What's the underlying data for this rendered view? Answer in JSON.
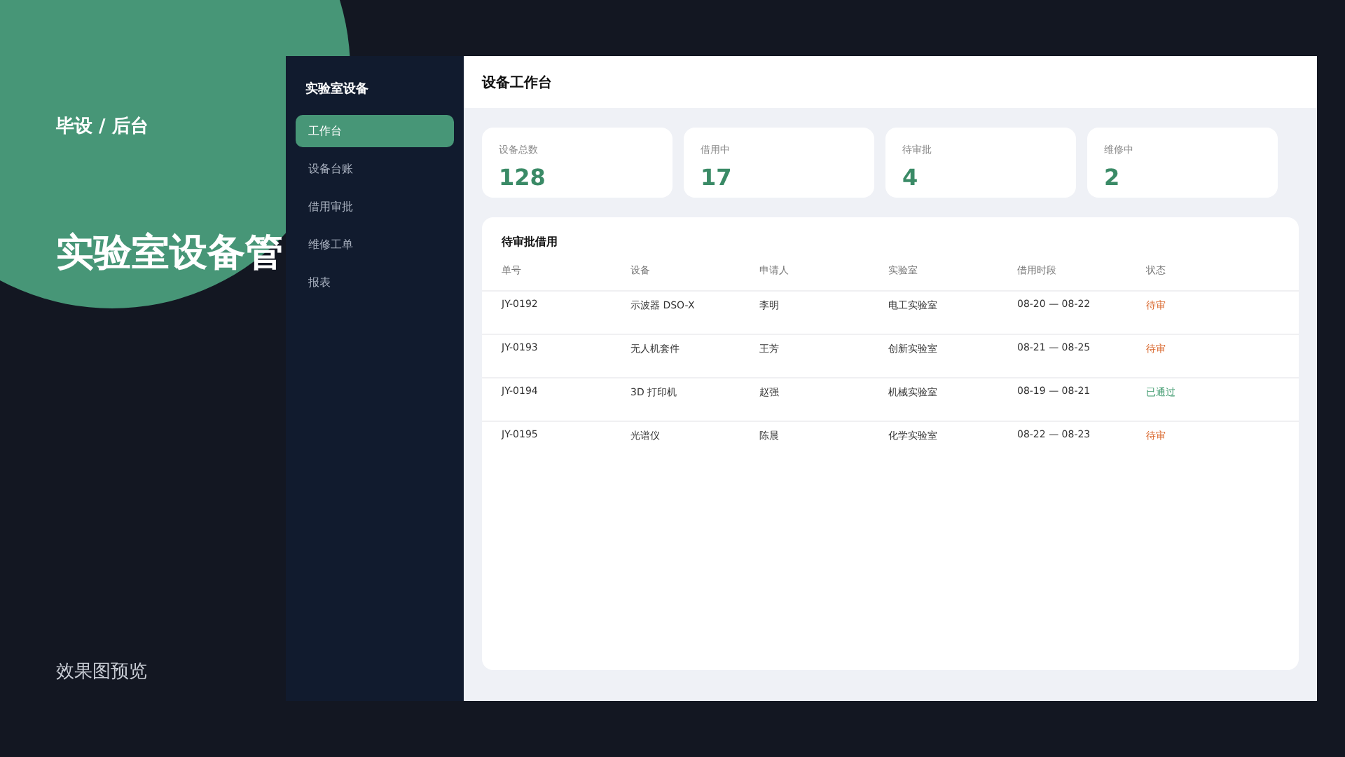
{
  "cover": {
    "label": "毕设 / 后台",
    "title": "实验室设备管",
    "footer": "效果图预览"
  },
  "sidebar": {
    "title": "实验室设备",
    "items": [
      {
        "label": "工作台",
        "selected": true
      },
      {
        "label": "设备台账",
        "selected": false
      },
      {
        "label": "借用审批",
        "selected": false
      },
      {
        "label": "维修工单",
        "selected": false
      },
      {
        "label": "报表",
        "selected": false
      }
    ]
  },
  "header": {
    "title": "设备工作台"
  },
  "stats": [
    {
      "label": "设备总数",
      "value": "128"
    },
    {
      "label": "借用中",
      "value": "17"
    },
    {
      "label": "待审批",
      "value": "4"
    },
    {
      "label": "维修中",
      "value": "2"
    }
  ],
  "table": {
    "title": "待审批借用",
    "columns": [
      "单号",
      "设备",
      "申请人",
      "实验室",
      "借用时段",
      "状态"
    ],
    "rows": [
      {
        "cells": [
          "JY-0192",
          "示波器 DSO-X",
          "李明",
          "电工实验室",
          "08-20 — 08-22"
        ],
        "status": "待审",
        "color": "#d9662b"
      },
      {
        "cells": [
          "JY-0193",
          "无人机套件",
          "王芳",
          "创新实验室",
          "08-21 — 08-25"
        ],
        "status": "待审",
        "color": "#d9662b"
      },
      {
        "cells": [
          "JY-0194",
          "3D 打印机",
          "赵强",
          "机械实验室",
          "08-19 — 08-21"
        ],
        "status": "已通过",
        "color": "#3f9a6e"
      },
      {
        "cells": [
          "JY-0195",
          "光谱仪",
          "陈晨",
          "化学实验室",
          "08-22 — 08-23"
        ],
        "status": "待审",
        "color": "#d9662b"
      }
    ]
  }
}
